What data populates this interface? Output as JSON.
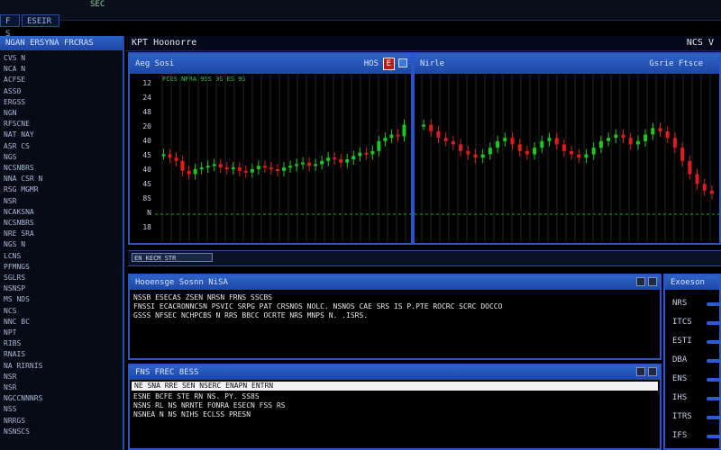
{
  "topbar": {
    "app_text": "SEC",
    "btn1": "F S",
    "btn2": "ESEIR"
  },
  "sidebar": {
    "header": "NGAN ERSYNA FRCRAS",
    "items": [
      "CVS N",
      "NCA N",
      "ACFSE",
      "ASS0",
      "ERGSS",
      "NGN",
      "RFSCNE",
      "NAT NAY",
      "ASR CS",
      "NGS",
      "NCSNBRS",
      "NNA CSR N",
      "RSG MGMR",
      "NSR",
      "NCAKSNA",
      "NCSNBRS",
      "NRE SRA",
      "NGS N",
      "LCNS",
      "PFMNGS",
      "SGLRS",
      "NSNSP",
      "MS NDS",
      "NCS",
      "NNC BC",
      "NPT",
      "RIBS",
      "RNAIS",
      "NA RIRNIS",
      "NSR",
      "NSR",
      "NGCCNNNRS",
      "NSS",
      "NRRGS",
      "NSNSCS"
    ]
  },
  "window": {
    "title": "KPT Hoonorre",
    "right": "NCS V"
  },
  "chart_left": {
    "title": "Aeg Sosi",
    "right_label": "HOS",
    "badge": "E",
    "legend": "FCES NFRA 9SS 9S ES 9S",
    "yticks": [
      "12",
      "24",
      "48",
      "20",
      "40",
      "45",
      "40",
      "4S",
      "8S",
      "N",
      "18"
    ]
  },
  "chart_right": {
    "title": "Nirle",
    "right_label": "Gsrie Ftsce"
  },
  "statusbar": {
    "text": "EN KECM STR"
  },
  "terminal1": {
    "title": "Hooensge Sosnn NiSA",
    "lines": [
      "NSSB ESECAS ZSEN NRSN FRNS  SSCBS",
      "FNSSI ECACRONNCSN PSVIC SRPG  PAT CRSNOS NOLC. NSNOS CAE SRS IS  P.PTE  ROCRC  SCRC  DOCCO",
      "GSSS NFSEC NCHPCBS N RRS BBCC OCRTE NRS  MNPS N. .ISRS."
    ]
  },
  "terminal2": {
    "title": "FNS  FREC 8ESS",
    "highlight": "NE SNA RRE SEN NSERC ENAPN ENTRN",
    "lines": [
      "ESNE BCFE  STE RN  NS. PY. SS8S",
      "NSNS RL  NS NRNTE FONRA ESECN FSS RS",
      "NSNEA N NS NIHS ECLSS PRESN"
    ]
  },
  "right_panel": {
    "title": "Exoeson",
    "labels": [
      "NRS",
      "ITCS",
      "ESTI",
      "DBA",
      "ENS",
      "IHS",
      "ITRS",
      "IFS"
    ]
  },
  "colors": {
    "accent": "#2b55c4",
    "bull": "#1ec81e",
    "bear": "#e21b1b",
    "background": "#000000"
  },
  "chart_data": [
    {
      "type": "candlestick",
      "title": "Aeg Sosi",
      "series": [
        {
          "name": "price",
          "values": [
            62,
            60,
            58,
            52,
            50,
            53,
            54,
            55,
            56,
            54,
            53,
            54,
            52,
            51,
            53,
            55,
            54,
            53,
            52,
            54,
            55,
            56,
            57,
            55,
            56,
            58,
            60,
            59,
            57,
            59,
            61,
            63,
            62,
            64,
            70,
            72,
            74,
            73,
            80
          ]
        }
      ]
    },
    {
      "type": "candlestick",
      "title": "Nirle",
      "series": [
        {
          "name": "price",
          "values": [
            80,
            76,
            72,
            70,
            68,
            64,
            62,
            60,
            62,
            66,
            70,
            72,
            68,
            64,
            62,
            66,
            70,
            72,
            68,
            64,
            62,
            60,
            62,
            66,
            70,
            72,
            74,
            72,
            68,
            70,
            74,
            78,
            76,
            72,
            66,
            58,
            50,
            44,
            40,
            38
          ]
        }
      ]
    }
  ]
}
